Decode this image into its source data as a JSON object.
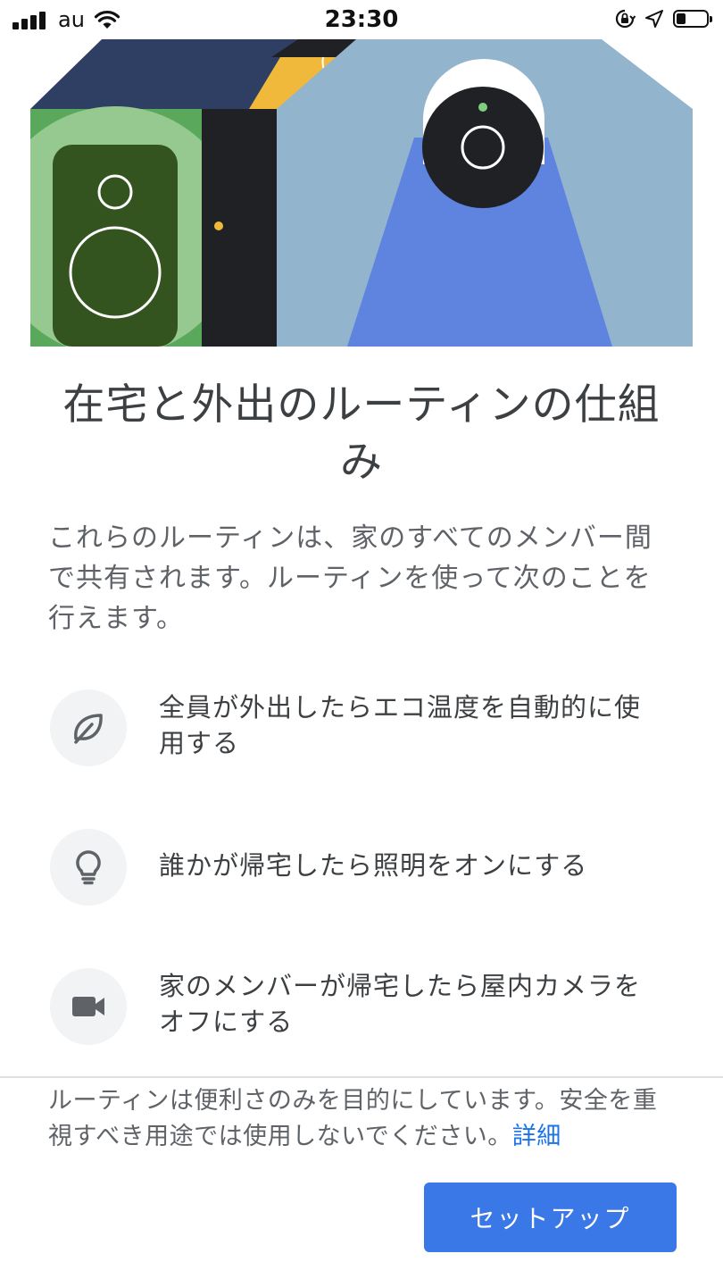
{
  "status_bar": {
    "carrier": "au",
    "time": "23:30",
    "battery_level": 0.3
  },
  "hero": {
    "illustration": "home-speaker-door-camera-illustration",
    "colors": {
      "roof_navy": "#2f3f63",
      "roof_yellow": "#f0b93b",
      "green_light": "#96c98f",
      "green_wall": "#5aa85b",
      "speaker": "#33531f",
      "door": "#202124",
      "house_blue": "#93b4cd",
      "camera_beam": "#5e84e0"
    }
  },
  "title": "在宅と外出のルーティンの仕組み",
  "description": "これらのルーティンは、家のすべてのメンバー間で共有されます。ルーティンを使って次のことを行えます。",
  "features": [
    {
      "icon": "leaf-icon",
      "text": "全員が外出したらエコ温度を自動的に使用する"
    },
    {
      "icon": "lightbulb-icon",
      "text": "誰かが帰宅したら照明をオンにする"
    },
    {
      "icon": "video-camera-icon",
      "text": "家のメンバーが帰宅したら屋内カメラをオフにする"
    }
  ],
  "footer": {
    "note": "ルーティンは便利さのみを目的にしています。安全を重視すべき用途では使用しないでください。",
    "link": "詳細"
  },
  "setup_button": "セットアップ",
  "accent_color": "#3b78e7"
}
